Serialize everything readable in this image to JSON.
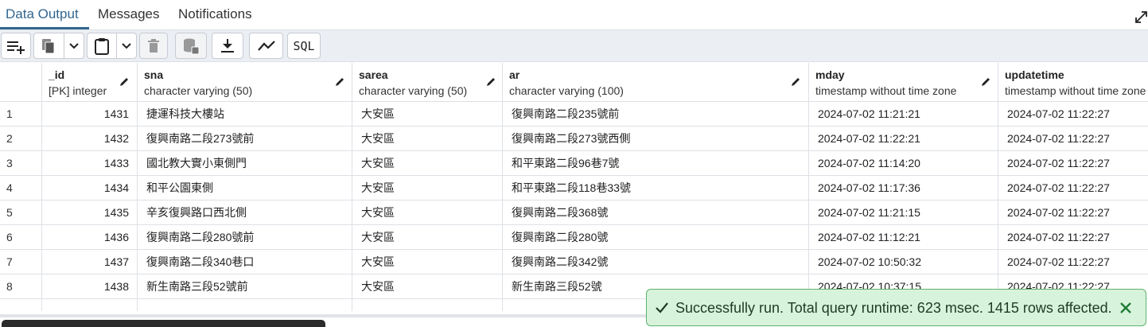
{
  "tabs": [
    {
      "label": "Data Output",
      "active": true
    },
    {
      "label": "Messages",
      "active": false
    },
    {
      "label": "Notifications",
      "active": false
    }
  ],
  "toolbar": {
    "buttons": [
      "add-row-icon",
      "copy-icon",
      "chevron-down-icon",
      "paste-icon",
      "chevron-down-icon",
      "delete-icon",
      "save-data-icon",
      "download-icon",
      "graph-icon"
    ],
    "sql_label": "SQL"
  },
  "columns": [
    {
      "name": "_id",
      "type": "[PK] integer"
    },
    {
      "name": "sna",
      "type": "character varying (50)"
    },
    {
      "name": "sarea",
      "type": "character varying (50)"
    },
    {
      "name": "ar",
      "type": "character varying (100)"
    },
    {
      "name": "mday",
      "type": "timestamp without time zone"
    },
    {
      "name": "updatetime",
      "type": "timestamp without time zone"
    }
  ],
  "rows": [
    {
      "n": "1",
      "id": "1431",
      "sna": "捷運科技大樓站",
      "sarea": "大安區",
      "ar": "復興南路二段235號前",
      "mday": "2024-07-02 11:21:21",
      "updatetime": "2024-07-02 11:22:27"
    },
    {
      "n": "2",
      "id": "1432",
      "sna": "復興南路二段273號前",
      "sarea": "大安區",
      "ar": "復興南路二段273號西側",
      "mday": "2024-07-02 11:22:21",
      "updatetime": "2024-07-02 11:22:27"
    },
    {
      "n": "3",
      "id": "1433",
      "sna": "國北教大實小東側門",
      "sarea": "大安區",
      "ar": "和平東路二段96巷7號",
      "mday": "2024-07-02 11:14:20",
      "updatetime": "2024-07-02 11:22:27"
    },
    {
      "n": "4",
      "id": "1434",
      "sna": "和平公園東側",
      "sarea": "大安區",
      "ar": "和平東路二段118巷33號",
      "mday": "2024-07-02 11:17:36",
      "updatetime": "2024-07-02 11:22:27"
    },
    {
      "n": "5",
      "id": "1435",
      "sna": "辛亥復興路口西北側",
      "sarea": "大安區",
      "ar": "復興南路二段368號",
      "mday": "2024-07-02 11:21:15",
      "updatetime": "2024-07-02 11:22:27"
    },
    {
      "n": "6",
      "id": "1436",
      "sna": "復興南路二段280號前",
      "sarea": "大安區",
      "ar": "復興南路二段280號",
      "mday": "2024-07-02 11:12:21",
      "updatetime": "2024-07-02 11:22:27"
    },
    {
      "n": "7",
      "id": "1437",
      "sna": "復興南路二段340巷口",
      "sarea": "大安區",
      "ar": "復興南路二段342號",
      "mday": "2024-07-02 10:50:32",
      "updatetime": "2024-07-02 11:22:27"
    },
    {
      "n": "8",
      "id": "1438",
      "sna": "新生南路三段52號前",
      "sarea": "大安區",
      "ar": "新生南路三段52號",
      "mday": "2024-07-02 10:37:15",
      "updatetime": "2024-07-02 11:22:27"
    }
  ],
  "toast": {
    "message": "Successfully run. Total query runtime: 623 msec. 1415 rows affected.",
    "accent": "#1e7e34"
  },
  "colors": {
    "active_tab": "#326690",
    "toolbar_bg": "#ebeef3",
    "toast_bg": "#d8f3dc",
    "toast_border": "#5fb36e"
  }
}
